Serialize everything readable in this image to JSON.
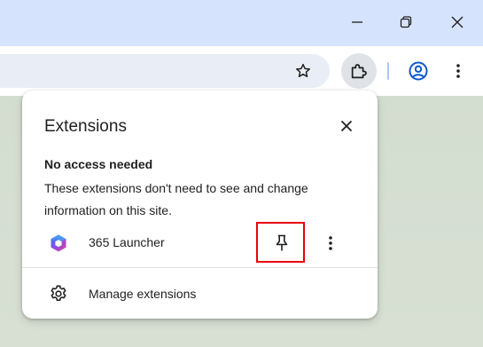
{
  "window_controls": {
    "minimize_icon": "minimize-icon",
    "restore_icon": "restore-icon",
    "close_icon": "close-icon"
  },
  "toolbar": {
    "bookmark_icon": "star-icon",
    "extensions_icon": "puzzle-icon",
    "profile_icon": "profile-icon",
    "menu_icon": "kebab-menu-icon"
  },
  "popup": {
    "title": "Extensions",
    "section_heading": "No access needed",
    "section_description": "These extensions don't need to see and change information on this site.",
    "extensions": [
      {
        "name": "365 Launcher",
        "icon": "microsoft-365-icon",
        "pinned": false
      }
    ],
    "manage_label": "Manage extensions"
  },
  "colors": {
    "titlebar": "#d6e3fc",
    "highlight_box": "#e8000b",
    "profile_accent": "#0b57d0",
    "toolbar_separator": "#a8c7fa"
  }
}
